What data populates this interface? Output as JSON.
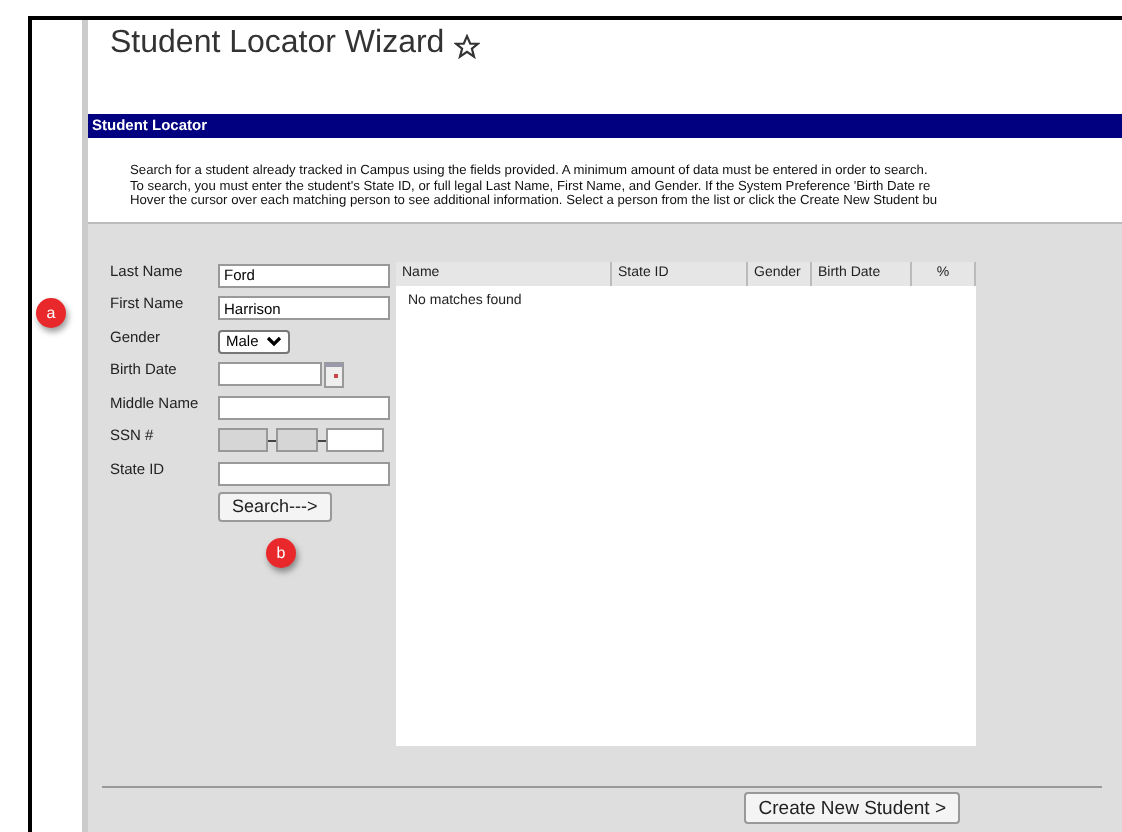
{
  "page": {
    "title": "Student Locator Wizard"
  },
  "section": {
    "title": "Student Locator"
  },
  "instructions": [
    "Search for a student already tracked in Campus using the fields provided. A minimum amount of data must be entered in order to search.",
    "To search, you must enter the student's State ID, or full legal Last Name, First Name, and Gender. If the System Preference 'Birth Date re",
    "Hover the cursor over each matching person to see additional information. Select a person from the list or click the Create New Student bu"
  ],
  "form": {
    "fields": [
      {
        "kind": "text",
        "label": "Last Name",
        "value": "Ford"
      },
      {
        "kind": "text",
        "label": "First Name",
        "value": "Harrison"
      },
      {
        "kind": "select",
        "label": "Gender",
        "value": "Male"
      },
      {
        "kind": "date",
        "label": "Birth Date"
      },
      {
        "kind": "text",
        "label": "Middle Name"
      },
      {
        "kind": "ssn",
        "label": "SSN #"
      },
      {
        "kind": "text",
        "label": "State ID"
      }
    ],
    "search_button": "Search--->"
  },
  "results": {
    "columns": [
      "Name",
      "State ID",
      "Gender",
      "Birth Date",
      "%"
    ],
    "empty_message": "No matches found"
  },
  "create_button": "Create New Student >",
  "callouts": [
    "a",
    "b"
  ]
}
